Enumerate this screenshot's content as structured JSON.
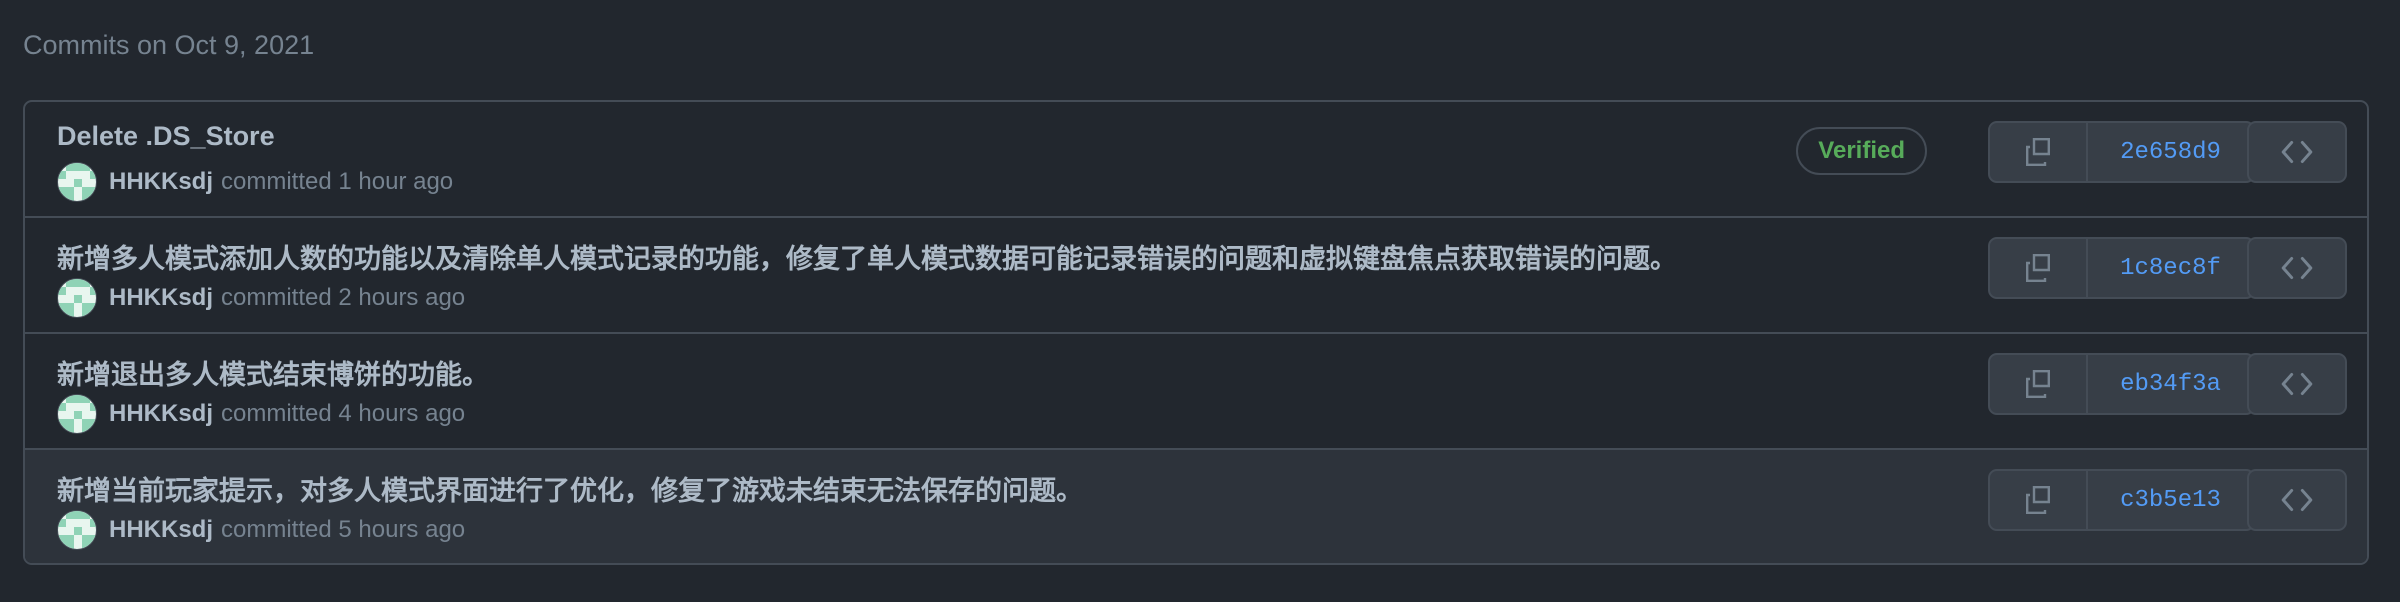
{
  "heading": "Commits on Oct 9, 2021",
  "commits": [
    {
      "title": "Delete .DS_Store",
      "author": "HHKKsdj",
      "time": "committed 1 hour ago",
      "verified": "Verified",
      "sha": "2e658d9"
    },
    {
      "title": "新增多人模式添加人数的功能以及清除单人模式记录的功能，修复了单人模式数据可能记录错误的问题和虚拟键盘焦点获取错误的问题。",
      "author": "HHKKsdj",
      "time": "committed 2 hours ago",
      "sha": "1c8ec8f"
    },
    {
      "title": "新增退出多人模式结束博饼的功能。",
      "author": "HHKKsdj",
      "time": "committed 4 hours ago",
      "sha": "eb34f3a"
    },
    {
      "title": "新增当前玩家提示，对多人模式界面进行了优化，修复了游戏未结束无法保存的问题。",
      "author": "HHKKsdj",
      "time": "committed 5 hours ago",
      "sha": "c3b5e13"
    }
  ],
  "icons": {
    "copy": "copy-icon",
    "browse": "code-icon",
    "avatar": "identicon-avatar"
  },
  "colors": {
    "verified": "#57ab5a",
    "sha_link": "#539bf5",
    "background": "#22272e",
    "border": "#444c56"
  }
}
